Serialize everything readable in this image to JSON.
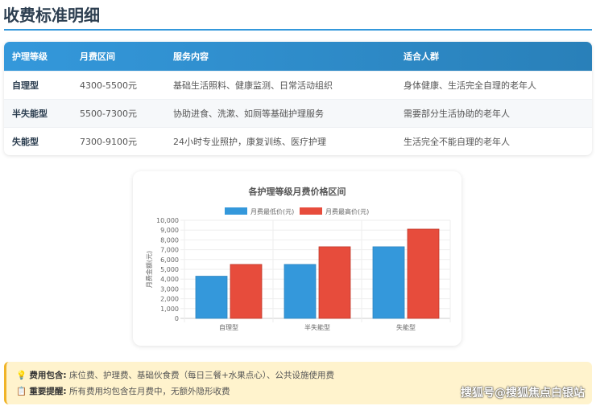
{
  "page_title": "收费标准明细",
  "table": {
    "headers": [
      "护理等级",
      "月费区间",
      "服务内容",
      "适合人群"
    ],
    "rows": [
      [
        "自理型",
        "4300-5500元",
        "基础生活照料、健康监测、日常活动组织",
        "身体健康、生活完全自理的老年人"
      ],
      [
        "半失能型",
        "5500-7300元",
        "协助进食、洗漱、如厕等基础护理服务",
        "需要部分生活协助的老年人"
      ],
      [
        "失能型",
        "7300-9100元",
        "24小时专业照护，康复训练、医疗护理",
        "生活完全不能自理的老年人"
      ]
    ]
  },
  "chart_data": {
    "type": "bar",
    "title": "各护理等级月费价格区间",
    "categories": [
      "自理型",
      "半失能型",
      "失能型"
    ],
    "series": [
      {
        "name": "月费最低价(元)",
        "values": [
          4300,
          5500,
          7300
        ],
        "color": "#3498db"
      },
      {
        "name": "月费最高价(元)",
        "values": [
          5500,
          7300,
          9100
        ],
        "color": "#e74c3c"
      }
    ],
    "ylabel": "月费金额(元)",
    "xlabel": "",
    "ylim": [
      0,
      10000
    ],
    "yticks": [
      "0",
      "1,000",
      "2,000",
      "3,000",
      "4,000",
      "5,000",
      "6,000",
      "7,000",
      "8,000",
      "9,000",
      "10,000"
    ],
    "legend": "top",
    "grid": true
  },
  "notes": {
    "fee_label": "费用包含:",
    "fee_text": "床位费、护理费、基础伙食费（每日三餐+水果点心）、公共设施使用费",
    "remind_label": "重要提醒:",
    "remind_text": "所有费用均包含在月费中，无额外隐形收费"
  },
  "watermark": "搜狐号@搜狐焦点白银站"
}
